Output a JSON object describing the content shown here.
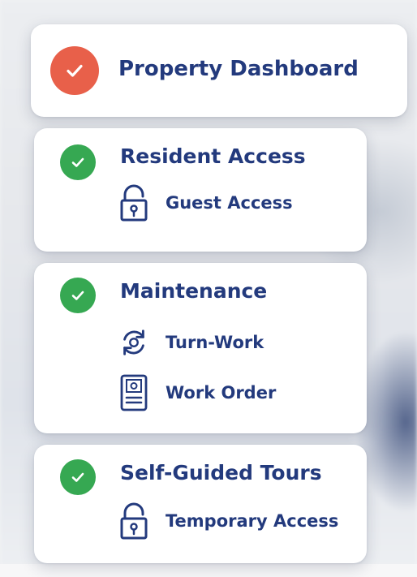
{
  "colors": {
    "primary_text": "#233a7d",
    "check_red": "#e8604a",
    "check_green": "#36a852",
    "card_bg": "#ffffff"
  },
  "cards": [
    {
      "title": "Property Dashboard",
      "status_icon": "check-circle-red-icon",
      "items": []
    },
    {
      "title": "Resident Access",
      "status_icon": "check-circle-green-icon",
      "items": [
        {
          "label": "Guest Access",
          "icon": "padlock-unlocked-icon"
        }
      ]
    },
    {
      "title": "Maintenance",
      "status_icon": "check-circle-green-icon",
      "items": [
        {
          "label": "Turn-Work",
          "icon": "refresh-gear-icon"
        },
        {
          "label": "Work Order",
          "icon": "document-gear-icon"
        }
      ]
    },
    {
      "title": "Self-Guided Tours",
      "status_icon": "check-circle-green-icon",
      "items": [
        {
          "label": "Temporary Access",
          "icon": "padlock-unlocked-icon"
        }
      ]
    }
  ]
}
